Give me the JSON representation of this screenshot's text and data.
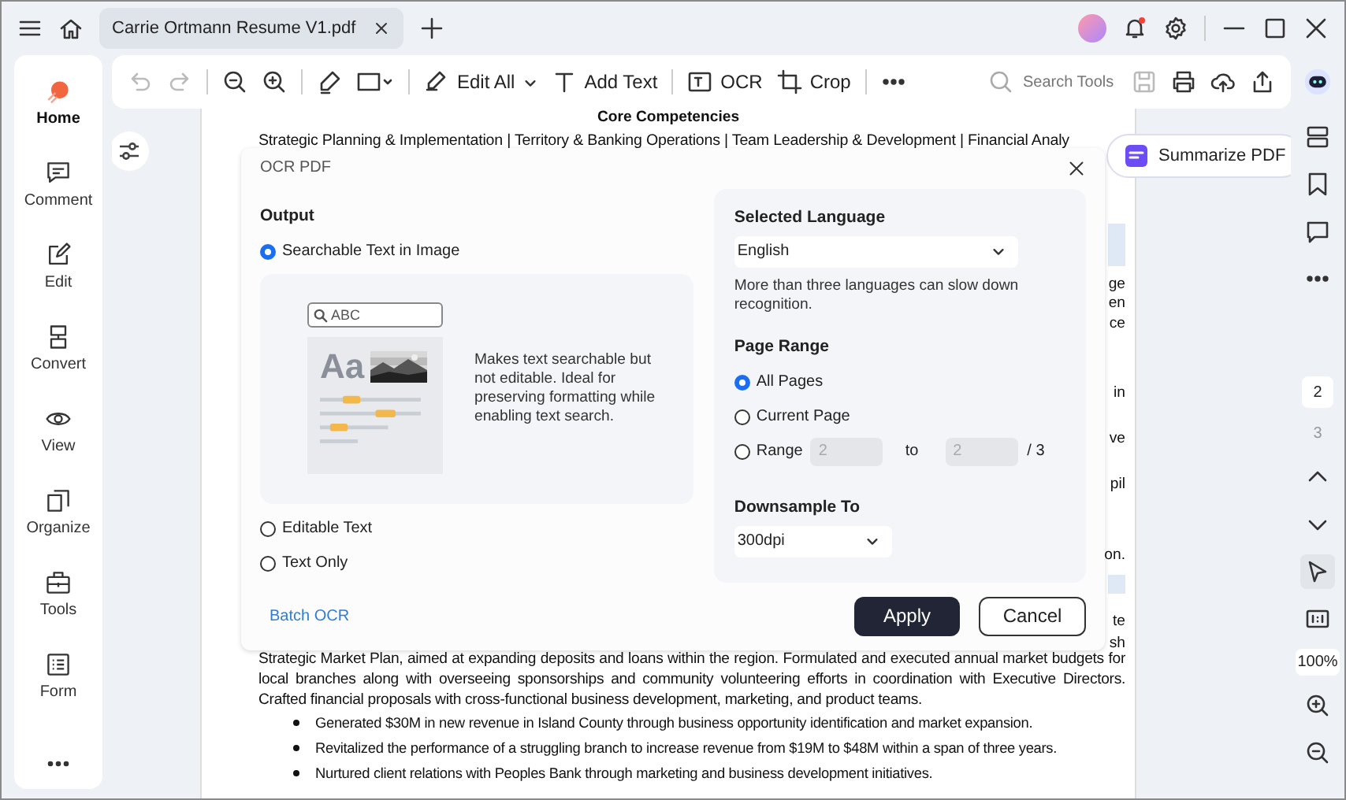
{
  "title_bar": {
    "tabs": [
      {
        "label": "Carrie Ortmann Resume V1.pdf",
        "selected": true
      }
    ],
    "notification": true
  },
  "sidebar": {
    "items": [
      {
        "label": "Home",
        "selected": true
      },
      {
        "label": "Comment",
        "selected": false
      },
      {
        "label": "Edit",
        "selected": false
      },
      {
        "label": "Convert",
        "selected": false
      },
      {
        "label": "View",
        "selected": false
      },
      {
        "label": "Organize",
        "selected": false
      },
      {
        "label": "Tools",
        "selected": false
      },
      {
        "label": "Form",
        "selected": false
      }
    ]
  },
  "toolbar": {
    "undo": {
      "disabled": true
    },
    "redo": {
      "disabled": true
    },
    "edit_all": "Edit All",
    "add_text": "Add Text",
    "ocr": "OCR",
    "crop": "Crop",
    "search": {
      "placeholder": "Search Tools"
    },
    "save": {
      "disabled": true
    }
  },
  "document": {
    "heading": "Core Competencies",
    "competencies": "Strategic Planning & Implementation | Territory & Banking Operations | Team Leadership & Development | Financial Analy",
    "fragments": [
      "ge",
      "en",
      "ce",
      "in",
      "ve",
      "pil",
      "on.",
      "te",
      "sh"
    ],
    "paragraph": "Strategic Market Plan, aimed at expanding deposits and loans within the region. Formulated and executed annual market budgets for local branches along with overseeing sponsorships and community volunteering efforts in coordination with Executive Directors. Crafted financial proposals with cross-functional business development, marketing, and product teams.",
    "bullets": [
      "Generated $30M in new revenue in Island County through business opportunity identification and market expansion.",
      "Revitalized the performance of a struggling branch to increase revenue from $19M to $48M within a span of three years.",
      "Nurtured client relations with Peoples Bank through marketing and business development initiatives."
    ]
  },
  "summarize_button": "Summarize PDF",
  "dialog": {
    "title": "OCR PDF",
    "output": {
      "heading": "Output",
      "options": [
        {
          "label": "Searchable Text in Image",
          "selected": true
        },
        {
          "label": "Editable Text",
          "selected": false
        },
        {
          "label": "Text Only",
          "selected": false
        }
      ],
      "preview": {
        "search_text": "ABC",
        "sample": "Aa",
        "description": "Makes text searchable but not editable. Ideal for preserving formatting while enabling text search."
      }
    },
    "language": {
      "heading": "Selected Language",
      "value": "English",
      "note": "More than three languages can slow down recognition."
    },
    "page_range": {
      "heading": "Page Range",
      "options": [
        {
          "label": "All Pages",
          "selected": true,
          "kind": "plain"
        },
        {
          "label": "Current Page",
          "selected": false,
          "kind": "plain"
        },
        {
          "label": "Range",
          "selected": false,
          "kind": "range"
        }
      ],
      "range_from": {
        "value": "2",
        "disabled": true
      },
      "to": "to",
      "range_to": {
        "value": "2",
        "disabled": true
      },
      "total": "/ 3"
    },
    "downsample": {
      "heading": "Downsample To",
      "value": "300dpi"
    },
    "batch_link": "Batch OCR",
    "apply": "Apply",
    "cancel": "Cancel"
  },
  "page_nav": {
    "pages": [
      {
        "label": "2",
        "selected": true
      },
      {
        "label": "3",
        "selected": false
      }
    ],
    "select_tool_active": true,
    "zoom": "100%"
  }
}
